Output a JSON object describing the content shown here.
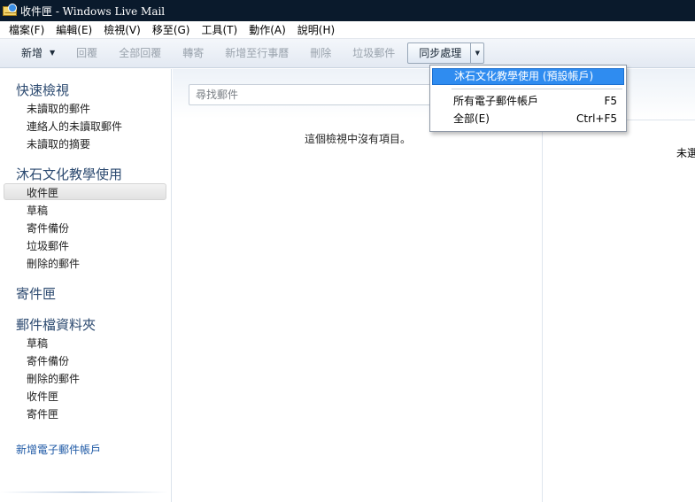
{
  "window": {
    "title": "收件匣 - Windows Live Mail",
    "icon": "windows-live-mail-icon"
  },
  "menubar": {
    "items": [
      {
        "label": "檔案(F)"
      },
      {
        "label": "編輯(E)"
      },
      {
        "label": "檢視(V)"
      },
      {
        "label": "移至(G)"
      },
      {
        "label": "工具(T)"
      },
      {
        "label": "動作(A)"
      },
      {
        "label": "說明(H)"
      }
    ]
  },
  "toolbar": {
    "new_label": "新增",
    "reply_label": "回覆",
    "reply_all_label": "全部回覆",
    "forward_label": "轉寄",
    "add_to_calendar_label": "新增至行事曆",
    "delete_label": "刪除",
    "junk_label": "垃圾郵件",
    "sync_label": "同步處理"
  },
  "sync_menu": {
    "items": [
      {
        "label": "沐石文化教學使用 (預設帳戶)",
        "shortcut": ""
      },
      {
        "label": "所有電子郵件帳戶",
        "shortcut": "F5"
      },
      {
        "label": "全部(E)",
        "shortcut": "Ctrl+F5"
      }
    ]
  },
  "sidebar": {
    "quick_views": {
      "header": "快速檢視",
      "items": [
        "未讀取的郵件",
        "連絡人的未讀取郵件",
        "未讀取的摘要"
      ]
    },
    "account": {
      "header": "沐石文化教學使用",
      "items": [
        "收件匣",
        "草稿",
        "寄件備份",
        "垃圾郵件",
        "刪除的郵件"
      ],
      "selected": "收件匣"
    },
    "outbox": {
      "header": "寄件匣"
    },
    "storage_folders": {
      "header": "郵件檔資料夾",
      "items": [
        "草稿",
        "寄件備份",
        "刪除的郵件",
        "收件匣",
        "寄件匣"
      ]
    },
    "add_account_label": "新增電子郵件帳戶"
  },
  "message_list": {
    "search_placeholder": "尋找郵件",
    "empty_text": "這個檢視中沒有項目。"
  },
  "reading_pane": {
    "text": "未選"
  },
  "colors": {
    "titlebar": "#0a1a2c",
    "highlight": "#2f8cf0",
    "section_header": "#2c4a70",
    "link": "#1f5aa6"
  }
}
